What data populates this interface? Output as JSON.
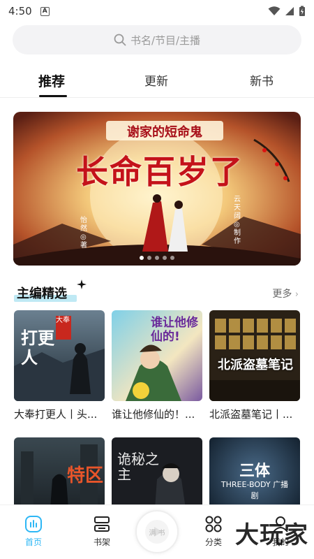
{
  "status": {
    "time": "4:50",
    "a_label": "A"
  },
  "search": {
    "placeholder": "书名/节目/主播"
  },
  "tabs": [
    {
      "label": "推荐",
      "active": true
    },
    {
      "label": "更新",
      "active": false
    },
    {
      "label": "新书",
      "active": false
    }
  ],
  "banner": {
    "subtitle": "谢家的短命鬼",
    "title": "长命百岁了",
    "author_left": "怡然◎著",
    "author_right": "云天阔◎制作",
    "dots": 5,
    "active_dot": 0
  },
  "section": {
    "title": "主编精选",
    "more_label": "更多"
  },
  "books": [
    {
      "title": "大奉打更人丨头...",
      "cover_text": "打更人",
      "cover_tag": "大奉"
    },
    {
      "title": "谁让他修仙的！...",
      "cover_text": "谁让他修仙的!",
      "cover_tag": ""
    },
    {
      "title": "北派盗墓笔记丨...",
      "cover_text": "北派盗墓笔记",
      "cover_tag": ""
    },
    {
      "title": "",
      "cover_text": "特区",
      "cover_tag": ""
    },
    {
      "title": "",
      "cover_text": "诡秘之主",
      "cover_tag": ""
    },
    {
      "title": "",
      "cover_text": "三体",
      "cover_tag": "THREE-BODY 广播剧"
    }
  ],
  "tabbar": {
    "home": "首页",
    "shelf": "书架",
    "play": "满 书",
    "category": "分类",
    "me": "我的"
  },
  "watermark": "大玩家",
  "colors": {
    "accent": "#2db7f5",
    "highlight": "#bfe9f4"
  }
}
